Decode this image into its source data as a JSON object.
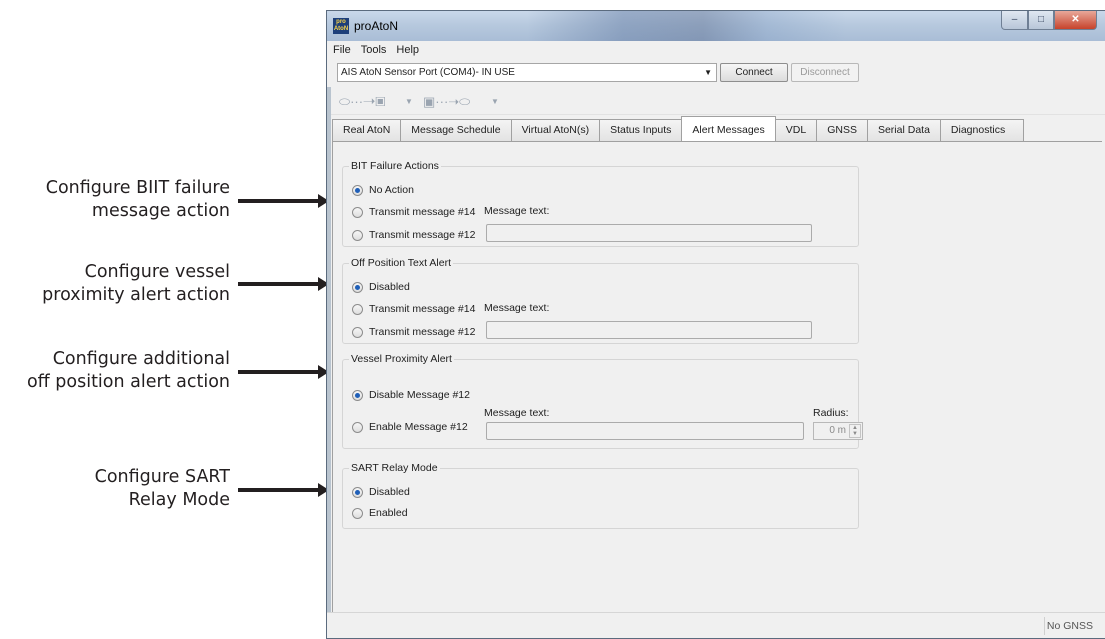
{
  "callouts": [
    {
      "line1": "Configure BIIT failure",
      "line2": "message action"
    },
    {
      "line1": "Configure vessel",
      "line2": "proximity alert action"
    },
    {
      "line1": "Configure additional",
      "line2": "off position alert action"
    },
    {
      "line1": "Configure SART",
      "line2": "Relay Mode"
    }
  ],
  "window": {
    "title": "proAtoN",
    "app_icon_text": "pro AtoN",
    "controls": {
      "minimize": "–",
      "maximize": "□",
      "close": "✕"
    }
  },
  "menu": [
    "File",
    "Tools",
    "Help"
  ],
  "toolbar": {
    "port_value": "AIS AtoN Sensor Port (COM4)- IN USE",
    "connect_label": "Connect",
    "disconnect_label": "Disconnect"
  },
  "icons": [
    "pc-to-device-icon",
    "device-to-pc-icon"
  ],
  "tabs": [
    "Real AtoN",
    "Message Schedule",
    "Virtual AtoN(s)",
    "Status Inputs",
    "Alert Messages",
    "VDL",
    "GNSS",
    "Serial Data",
    "Diagnostics"
  ],
  "active_tab": "Alert Messages",
  "bit_failure": {
    "title": "BIT Failure Actions",
    "options": [
      "No Action",
      "Transmit message #14",
      "Transmit message #12"
    ],
    "selected": "No Action",
    "message_text_label": "Message text:",
    "message_text_value": ""
  },
  "off_position": {
    "title": "Off Position Text Alert",
    "options": [
      "Disabled",
      "Transmit message #14",
      "Transmit message #12"
    ],
    "selected": "Disabled",
    "message_text_label": "Message text:",
    "message_text_value": ""
  },
  "vessel_proximity": {
    "title": "Vessel Proximity Alert",
    "options": [
      "Disable Message #12",
      "Enable Message #12"
    ],
    "selected": "Disable Message #12",
    "message_text_label": "Message text:",
    "message_text_value": "",
    "radius_label": "Radius:",
    "radius_value": "0 m"
  },
  "sart_relay": {
    "title": "SART Relay Mode",
    "options": [
      "Disabled",
      "Enabled"
    ],
    "selected": "Disabled"
  },
  "status": {
    "gnss": "No GNSS"
  }
}
